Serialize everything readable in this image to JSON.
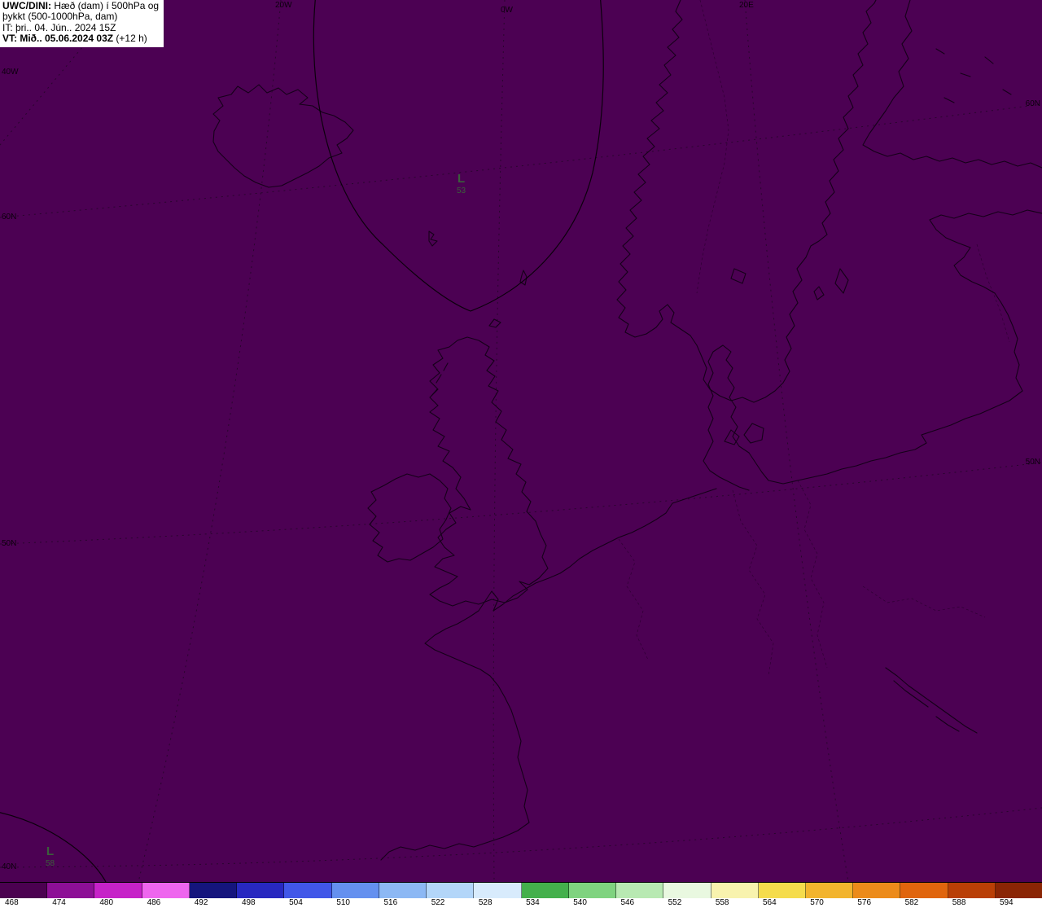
{
  "info_box": {
    "product_bold": "UWC/DINI:",
    "product_rest": " Hæð (dam) í 500hPa og",
    "product_line2": "þykkt (500-1000hPa, dam)",
    "init_time": "IT: þri.. 04. Jún.. 2024 15Z",
    "valid_bold": "VT: Mið.. 05.06.2024 03Z",
    "valid_rest": " (+12 h)"
  },
  "edge_labels": {
    "top": [
      "20W",
      "0W",
      "20E"
    ],
    "left": [
      "40W",
      "60N",
      "50N",
      "40N"
    ],
    "right": [
      "60N",
      "50N"
    ]
  },
  "markers": [
    {
      "symbol": "L",
      "value": "53"
    },
    {
      "symbol": "L",
      "value": "58"
    }
  ],
  "colorbar": {
    "unit": "dam",
    "labels": [
      "468",
      "474",
      "480",
      "486",
      "492",
      "498",
      "504",
      "510",
      "516",
      "522",
      "528",
      "534",
      "540",
      "546",
      "552",
      "558",
      "564",
      "570",
      "576",
      "582",
      "588",
      "594"
    ],
    "colors": [
      "#4b0150",
      "#8d0f96",
      "#c622c8",
      "#ee66ee",
      "#15157d",
      "#2828c0",
      "#4157e8",
      "#6490ef",
      "#8cb8f4",
      "#b3d6f9",
      "#d8ebfc",
      "#44b04c",
      "#7fd37f",
      "#b8e9b2",
      "#e9f8e0",
      "#f8f3ae",
      "#f5dc4c",
      "#f2b42d",
      "#ec8b1a",
      "#e0650d",
      "#b93f06",
      "#8a2504"
    ]
  },
  "colors": {
    "map_bg": "#4c0153",
    "coastline": "#150019",
    "graticule": "#29052e",
    "contour": "#000000",
    "marker": "#3b5e3b",
    "label": "#000000"
  }
}
